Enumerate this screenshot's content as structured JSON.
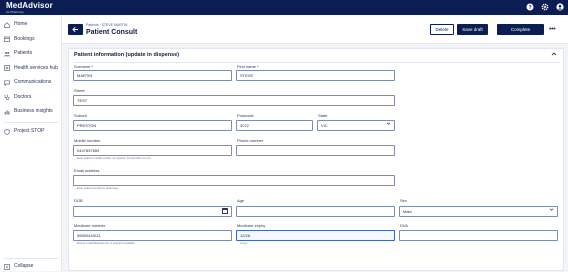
{
  "app": {
    "name": "MedAdvisor",
    "sub": "for Pharmacy"
  },
  "topbar": {
    "help_icon": "help-circle-icon",
    "settings_icon": "gear-icon",
    "account_icon": "user-circle-icon"
  },
  "sidebar": {
    "items": [
      {
        "label": "Home",
        "icon": "home-icon"
      },
      {
        "label": "Bookings",
        "icon": "calendar-icon"
      },
      {
        "label": "Patients",
        "icon": "people-icon"
      },
      {
        "label": "Health services hub",
        "icon": "health-icon"
      },
      {
        "label": "Communications",
        "icon": "chat-icon"
      },
      {
        "label": "Doctors",
        "icon": "stethoscope-icon"
      },
      {
        "label": "Business insights",
        "icon": "chart-icon"
      }
    ],
    "project": {
      "label": "Project STOP",
      "icon": "shield-icon"
    },
    "collapse": {
      "label": "Collapse",
      "icon": "collapse-icon"
    }
  },
  "header": {
    "breadcrumb": "Patients / STEVE MARTIN",
    "title": "Patient Consult",
    "delete_label": "Delete",
    "save_label": "Save draft",
    "complete_label": "Complete",
    "more_label": "•••"
  },
  "form": {
    "section_title": "Patient information (update in dispense)",
    "surname": {
      "label": "Surname *",
      "value": "MARTIN"
    },
    "first_name": {
      "label": "First name *",
      "value": "STEVE"
    },
    "street": {
      "label": "Street",
      "value": "TEST"
    },
    "suburb": {
      "label": "Suburb",
      "value": "PRESTON"
    },
    "postcode": {
      "label": "Postcode",
      "value": "3072"
    },
    "state": {
      "label": "State",
      "value": "VIC"
    },
    "mobile": {
      "label": "Mobile number",
      "value": "0447837659",
      "hint": "Enter patient's mobile number (no spaces). Format 04xx xxx xxx"
    },
    "phone": {
      "label": "Phone number",
      "value": ""
    },
    "email": {
      "label": "Email address",
      "value": "",
      "hint": "Enter patient's Email (for pharmacy)"
    },
    "dob": {
      "label": "DOB",
      "value": ""
    },
    "age": {
      "label": "Age",
      "value": ""
    },
    "sex": {
      "label": "Sex",
      "value": "Male"
    },
    "medicare_number": {
      "label": "Medicare number",
      "value": "55550445111",
      "hint": "Ensure a valid Medicare No. is entered if available"
    },
    "medicare_expiry": {
      "label": "Medicare expiry",
      "value": "12/28",
      "hint": "mm/yy"
    },
    "dva": {
      "label": "DVA",
      "value": ""
    }
  }
}
